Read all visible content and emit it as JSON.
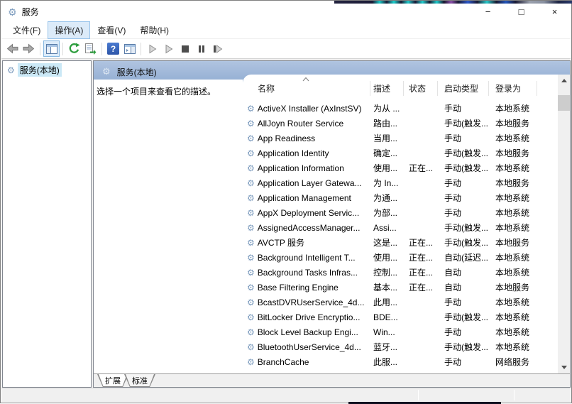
{
  "window": {
    "title": "服务",
    "controls": {
      "minimize": "−",
      "maximize": "□",
      "close": "×"
    }
  },
  "menu": {
    "items": [
      {
        "label": "文件(F)"
      },
      {
        "label": "操作(A)"
      },
      {
        "label": "查看(V)"
      },
      {
        "label": "帮助(H)"
      }
    ]
  },
  "toolbar": {
    "icons": [
      "back-icon",
      "forward-icon",
      "show-console-tree-icon",
      "refresh-icon",
      "export-list-icon",
      "help-icon",
      "show-action-pane-icon",
      "start-service-icon",
      "resume-service-icon",
      "stop-service-icon",
      "pause-service-icon",
      "restart-service-icon"
    ],
    "help_glyph": "?"
  },
  "sidebar": {
    "root_label": "服务(本地)"
  },
  "main": {
    "header_title": "服务(本地)",
    "description_hint": "选择一个项目来查看它的描述。",
    "columns": [
      "名称",
      "描述",
      "状态",
      "启动类型",
      "登录为"
    ],
    "services": [
      {
        "name": "ActiveX Installer (AxInstSV)",
        "desc": "为从 ...",
        "status": "",
        "startup": "手动",
        "logon": "本地系统"
      },
      {
        "name": "AllJoyn Router Service",
        "desc": "路由...",
        "status": "",
        "startup": "手动(触发...",
        "logon": "本地服务"
      },
      {
        "name": "App Readiness",
        "desc": "当用...",
        "status": "",
        "startup": "手动",
        "logon": "本地系统"
      },
      {
        "name": "Application Identity",
        "desc": "确定...",
        "status": "",
        "startup": "手动(触发...",
        "logon": "本地服务"
      },
      {
        "name": "Application Information",
        "desc": "使用...",
        "status": "正在...",
        "startup": "手动(触发...",
        "logon": "本地系统"
      },
      {
        "name": "Application Layer Gatewa...",
        "desc": "为 In...",
        "status": "",
        "startup": "手动",
        "logon": "本地服务"
      },
      {
        "name": "Application Management",
        "desc": "为通...",
        "status": "",
        "startup": "手动",
        "logon": "本地系统"
      },
      {
        "name": "AppX Deployment Servic...",
        "desc": "为部...",
        "status": "",
        "startup": "手动",
        "logon": "本地系统"
      },
      {
        "name": "AssignedAccessManager...",
        "desc": "Assi...",
        "status": "",
        "startup": "手动(触发...",
        "logon": "本地系统"
      },
      {
        "name": "AVCTP 服务",
        "desc": "这是...",
        "status": "正在...",
        "startup": "手动(触发...",
        "logon": "本地服务"
      },
      {
        "name": "Background Intelligent T...",
        "desc": "使用...",
        "status": "正在...",
        "startup": "自动(延迟...",
        "logon": "本地系统"
      },
      {
        "name": "Background Tasks Infras...",
        "desc": "控制...",
        "status": "正在...",
        "startup": "自动",
        "logon": "本地系统"
      },
      {
        "name": "Base Filtering Engine",
        "desc": "基本...",
        "status": "正在...",
        "startup": "自动",
        "logon": "本地服务"
      },
      {
        "name": "BcastDVRUserService_4d...",
        "desc": "此用...",
        "status": "",
        "startup": "手动",
        "logon": "本地系统"
      },
      {
        "name": "BitLocker Drive Encryptio...",
        "desc": "BDE...",
        "status": "",
        "startup": "手动(触发...",
        "logon": "本地系统"
      },
      {
        "name": "Block Level Backup Engi...",
        "desc": "Win...",
        "status": "",
        "startup": "手动",
        "logon": "本地系统"
      },
      {
        "name": "BluetoothUserService_4d...",
        "desc": "蓝牙...",
        "status": "",
        "startup": "手动(触发...",
        "logon": "本地系统"
      },
      {
        "name": "BranchCache",
        "desc": "此服...",
        "status": "",
        "startup": "手动",
        "logon": "网络服务"
      },
      {
        "name": "",
        "desc": "",
        "status": "",
        "startup": "",
        "logon": ""
      }
    ],
    "tabs": [
      {
        "label": "扩展"
      },
      {
        "label": "标准"
      }
    ]
  },
  "colors": {
    "header_blue": "#9db5d8",
    "selection_blue": "#cbe8f6",
    "menu_highlight": "#dcebf9",
    "help_blue": "#3566c4",
    "refresh_green": "#2e9e3e"
  }
}
